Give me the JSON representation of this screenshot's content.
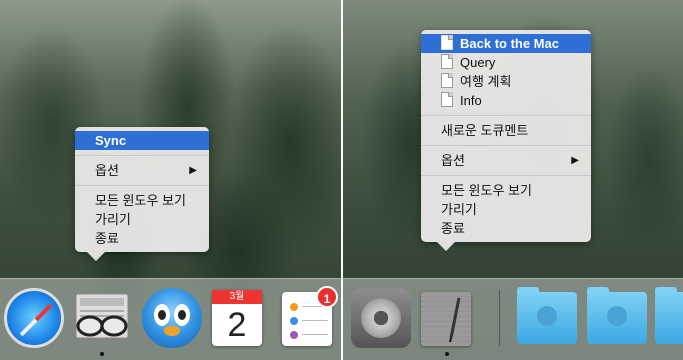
{
  "left_panel": {
    "menu": {
      "items": [
        {
          "label": "Sync",
          "selected": true
        },
        {
          "separator": true
        },
        {
          "label": "옵션",
          "submenu": true
        },
        {
          "separator": true
        },
        {
          "label": "모든 윈도우 보기"
        },
        {
          "label": "가리기"
        },
        {
          "label": "종료"
        }
      ],
      "submenu_arrow": "▶"
    },
    "dock": {
      "calendar_month": "3월",
      "calendar_day": "2",
      "reminders_badge": "1"
    }
  },
  "right_panel": {
    "menu": {
      "recent_docs": [
        "Back to the Mac",
        "Query",
        "여행 계획",
        "Info"
      ],
      "new_document": "새로운 도큐멘트",
      "options": "옵션",
      "show_all_windows": "모든 윈도우 보기",
      "hide": "가리기",
      "quit": "종료",
      "submenu_arrow": "▶"
    }
  },
  "icons": {
    "safari": "safari-icon",
    "reader": "glasses-icon",
    "tweetbot": "tweetbot-icon",
    "calendar": "calendar-icon",
    "reminders": "reminders-icon",
    "system_preferences": "gear-icon",
    "notes": "notepad-icon",
    "folder": "folder-icon"
  },
  "colors": {
    "selection": "#2e6fd6",
    "badge": "#e8302e"
  }
}
